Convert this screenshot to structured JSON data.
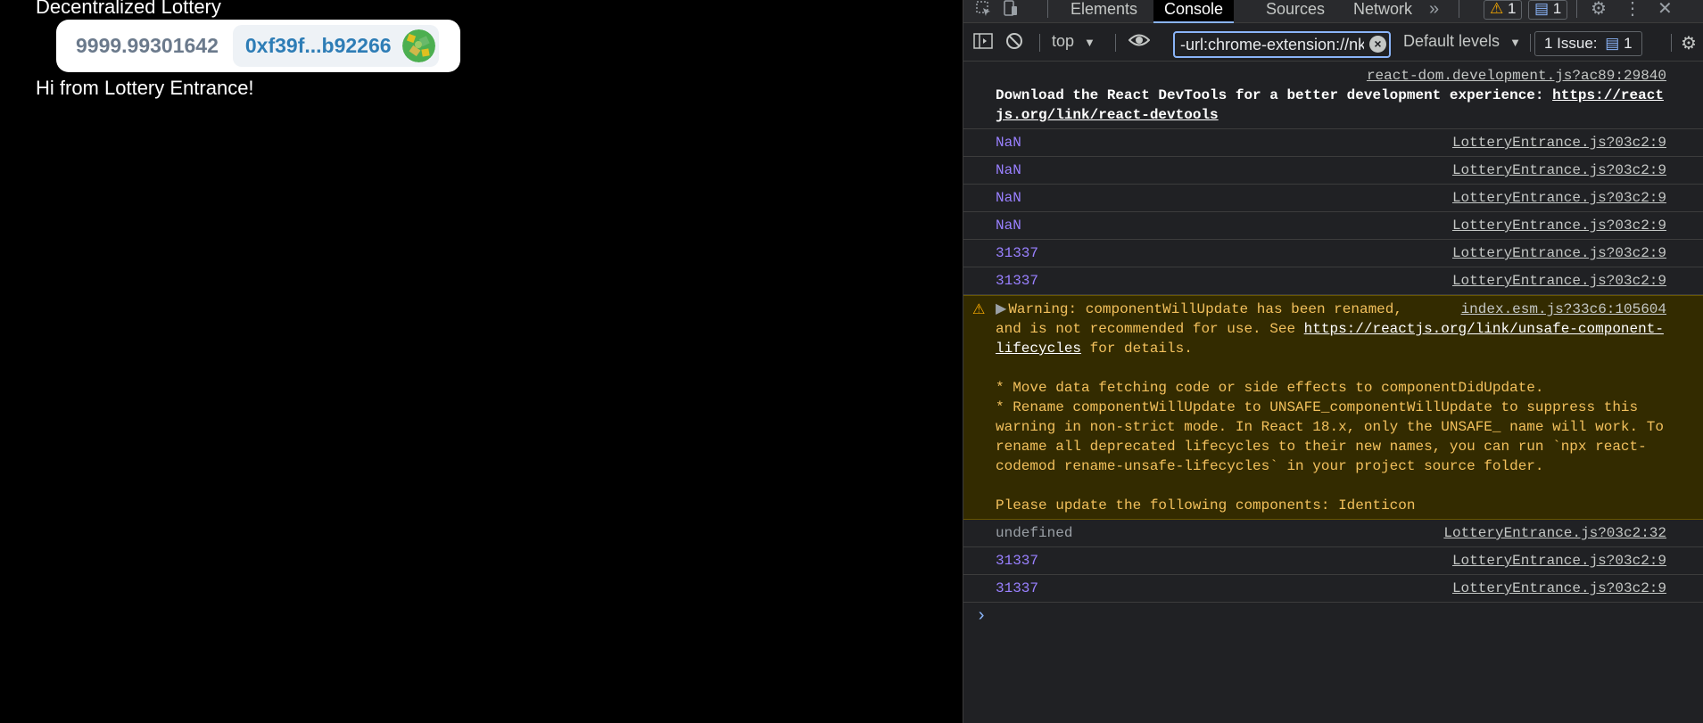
{
  "page": {
    "title": "Decentralized Lottery",
    "wallet": {
      "balance": "9999.99301642",
      "address": "0xf39f...b92266",
      "identicon_colors": [
        "#4caf50",
        "#e0c020",
        "#69b96a",
        "#d2b84a"
      ]
    },
    "greeting": "Hi from Lottery Entrance!"
  },
  "devtools": {
    "tabs": [
      "Elements",
      "Console",
      "Sources",
      "Network"
    ],
    "active_tab": "Console",
    "more_tabs_icon": "double-chevron-right-icon",
    "warnings_badge": "1",
    "messages_badge": "1",
    "context": "top",
    "filter_value": "-url:chrome-extension://nk",
    "levels": "Default levels",
    "issues": "1 Issue:",
    "issues_count": "1",
    "colors": {
      "accent": "#8ab4f8",
      "number": "#9980ff",
      "warning_bg": "#332b00",
      "warning_text": "#f2c05c"
    },
    "console": {
      "info": {
        "source": "react-dom.development.js?ac89:29840",
        "text": "Download the React DevTools for a better development experience: ",
        "link": "https://reactjs.org/link/react-devtools"
      },
      "logs_before": [
        {
          "value": "NaN",
          "source": "LotteryEntrance.js?03c2:9"
        },
        {
          "value": "NaN",
          "source": "LotteryEntrance.js?03c2:9"
        },
        {
          "value": "NaN",
          "source": "LotteryEntrance.js?03c2:9"
        },
        {
          "value": "NaN",
          "source": "LotteryEntrance.js?03c2:9"
        },
        {
          "value": "31337",
          "source": "LotteryEntrance.js?03c2:9"
        },
        {
          "value": "31337",
          "source": "LotteryEntrance.js?03c2:9"
        }
      ],
      "warning": {
        "source": "index.esm.js?33c6:105604",
        "line1": "Warning: componentWillUpdate has been renamed,",
        "line2": "and is not recommended for use. See ",
        "link": "https://reactjs.org/link/unsafe-component-lifecycles",
        "line3": " for details.",
        "body": "* Move data fetching code or side effects to componentDidUpdate.\n* Rename componentWillUpdate to UNSAFE_componentWillUpdate to suppress this warning in non-strict mode. In React 18.x, only the UNSAFE_ name will work. To rename all deprecated lifecycles to their new names, you can run `npx react-codemod rename-unsafe-lifecycles` in your project source folder.\n\nPlease update the following components: Identicon"
      },
      "logs_after": [
        {
          "value": "undefined",
          "source": "LotteryEntrance.js?03c2:32",
          "kind": "undef"
        },
        {
          "value": "31337",
          "source": "LotteryEntrance.js?03c2:9",
          "kind": "num"
        },
        {
          "value": "31337",
          "source": "LotteryEntrance.js?03c2:9",
          "kind": "num"
        }
      ],
      "prompt_symbol": "›"
    }
  }
}
